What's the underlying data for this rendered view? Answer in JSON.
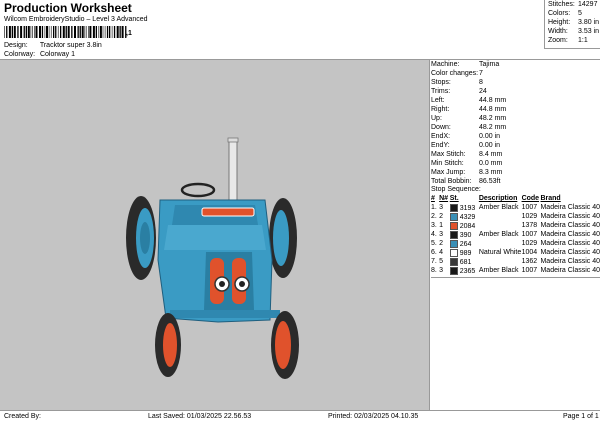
{
  "header": {
    "title": "Production Worksheet",
    "subtitle": "Wilcom EmbroideryStudio – Level 3 Advanced",
    "barcode_text": ",1",
    "design_label": "Design:",
    "design_value": "Tracktor super 3.8in",
    "colorway_label": "Colorway:",
    "colorway_value": "Colorway 1"
  },
  "top_stats": [
    {
      "label": "Stitches:",
      "value": "14297"
    },
    {
      "label": "Colors:",
      "value": "5"
    },
    {
      "label": "Height:",
      "value": "3.80 in"
    },
    {
      "label": "Width:",
      "value": "3.53 in"
    },
    {
      "label": "Zoom:",
      "value": "1:1"
    }
  ],
  "machine_info": [
    {
      "label": "Machine:",
      "value": "Tajima"
    },
    {
      "label": "Color changes:",
      "value": "7"
    },
    {
      "label": "Stops:",
      "value": "8"
    },
    {
      "label": "Trims:",
      "value": "24"
    },
    {
      "label": "Left:",
      "value": "44.8 mm"
    },
    {
      "label": "Right:",
      "value": "44.8 mm"
    },
    {
      "label": "Up:",
      "value": "48.2 mm"
    },
    {
      "label": "Down:",
      "value": "48.2 mm"
    },
    {
      "label": "EndX:",
      "value": "0.00 in"
    },
    {
      "label": "EndY:",
      "value": "0.00 in"
    },
    {
      "label": "Max Stitch:",
      "value": "8.4 mm"
    },
    {
      "label": "Min Stitch:",
      "value": "0.0 mm"
    },
    {
      "label": "Max Jump:",
      "value": "8.3 mm"
    },
    {
      "label": "Total Bobbin:",
      "value": "86.53ft"
    }
  ],
  "stop_sequence": {
    "title": "Stop Sequence:",
    "headers": [
      "#",
      "N#",
      "St.",
      "Description",
      "Code",
      "Brand"
    ],
    "rows": [
      {
        "idx": "1.",
        "n": "3",
        "color": "#1a1a1a",
        "st": "3193",
        "desc": "Amber Black",
        "code": "1007",
        "brand": "Madeira Classic 40"
      },
      {
        "idx": "2.",
        "n": "2",
        "color": "#3a8fb5",
        "st": "4329",
        "desc": "",
        "code": "1029",
        "brand": "Madeira Classic 40"
      },
      {
        "idx": "3.",
        "n": "1",
        "color": "#e0522c",
        "st": "2084",
        "desc": "",
        "code": "1378",
        "brand": "Madeira Classic 40"
      },
      {
        "idx": "4.",
        "n": "3",
        "color": "#1a1a1a",
        "st": "390",
        "desc": "Amber Black",
        "code": "1007",
        "brand": "Madeira Classic 40"
      },
      {
        "idx": "5.",
        "n": "2",
        "color": "#3a8fb5",
        "st": "264",
        "desc": "",
        "code": "1029",
        "brand": "Madeira Classic 40"
      },
      {
        "idx": "6.",
        "n": "4",
        "color": "#ffffff",
        "st": "989",
        "desc": "Natural White",
        "code": "1004",
        "brand": "Madeira Classic 40"
      },
      {
        "idx": "7.",
        "n": "5",
        "color": "#3a3a3a",
        "st": "681",
        "desc": "",
        "code": "1362",
        "brand": "Madeira Classic 40"
      },
      {
        "idx": "8.",
        "n": "3",
        "color": "#1a1a1a",
        "st": "2365",
        "desc": "Amber Black",
        "code": "1007",
        "brand": "Madeira Classic 40"
      }
    ]
  },
  "footer": {
    "created_by": "Created By:",
    "last_saved": "Last Saved: 01/03/2025 22.56.53",
    "printed": "Printed: 02/03/2025 04.10.35",
    "page": "Page 1 of 1"
  },
  "design_preview": {
    "icon": "tractor-embroidery-icon",
    "body_color": "#3a9bc4",
    "accent_color": "#e0522c",
    "tire_color": "#2a2a2a",
    "background_color": "#c4c4c4"
  }
}
